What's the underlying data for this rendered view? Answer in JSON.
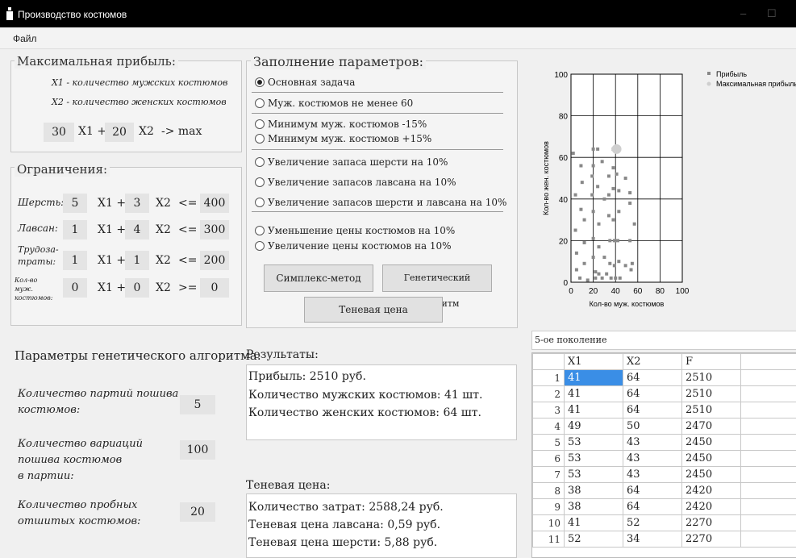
{
  "window": {
    "title": "Производство костюмов"
  },
  "menu": {
    "file": "Файл"
  },
  "maxprofit": {
    "title": "Максимальная прибыль:",
    "x1_desc": "X1 - количество мужских костюмов",
    "x2_desc": "X2 - количество женских костюмов",
    "c1": "30",
    "x1": "X1 +",
    "c2": "20",
    "x2": "X2",
    "arrow": "-> max"
  },
  "constraints": {
    "title": "Ограничения:",
    "rows": [
      {
        "label": "Шерсть:",
        "a": "5",
        "x1": "X1 +",
        "b": "3",
        "x2": "X2",
        "op": "<=",
        "rhs": "400"
      },
      {
        "label": "Лавсан:",
        "a": "1",
        "x1": "X1 +",
        "b": "4",
        "x2": "X2",
        "op": "<=",
        "rhs": "300"
      },
      {
        "label": "Трудоза-\nтраты:",
        "a": "1",
        "x1": "X1 +",
        "b": "1",
        "x2": "X2",
        "op": "<=",
        "rhs": "200"
      },
      {
        "label": "Кол-во муж. костюмов:",
        "a": "0",
        "x1": "X1 +",
        "b": "0",
        "x2": "X2",
        "op": ">=",
        "rhs": "0"
      }
    ]
  },
  "params": {
    "title": "Заполнение параметров:",
    "options": [
      "Основная задача",
      "Муж. костюмов не менее 60",
      "Минимум муж. костюмов -15%",
      "Минимум муж. костюмов +15%",
      "Увеличение запаса шерсти на 10%",
      "Увеличение запасов лавсана на 10%",
      "Увеличение запасов шерсти и лавсана на 10%",
      "Уменьшение цены костюмов на 10%",
      "Увеличение цены костюмов на 10%"
    ],
    "selected": 0
  },
  "buttons": {
    "simplex": "Симплекс-метод",
    "genetic": "Генетический алгоритм",
    "shadow": "Теневая цена"
  },
  "ga": {
    "title": "Параметры генетического алгоритма:",
    "p1_label": "Количество партий пошива\nкостюмов:",
    "p1": "5",
    "p2_label": "Количество вариаций\nпошива костюмов\nв партии:",
    "p2": "100",
    "p3_label": "Количество пробных\nотшитых костюмов:",
    "p3": "20"
  },
  "results": {
    "title": "Результаты:",
    "lines": [
      "Прибыль: 2510 руб.",
      "Количество мужских костюмов: 41 шт.",
      "Количество женских костюмов: 64 шт."
    ]
  },
  "shadow": {
    "title": "Теневая цена:",
    "lines": [
      "Количество затрат: 2588,24 руб.",
      "Теневая цена лавсана: 0,59 руб.",
      "Теневая цена шерсти: 5,88 руб."
    ]
  },
  "chart_data": {
    "type": "scatter",
    "xlabel": "Кол-во муж. костюмов",
    "ylabel": "Кол-во жен. костюмов",
    "xlim": [
      0,
      100
    ],
    "ylim": [
      0,
      100
    ],
    "xticks": [
      "0",
      "20",
      "40",
      "60",
      "80",
      "100"
    ],
    "yticks": [
      "0",
      "20",
      "40",
      "60",
      "80",
      "100"
    ],
    "grid": true,
    "legend_position": "top-right",
    "series": [
      {
        "name": "Прибыль",
        "color": "#888888",
        "points": [
          [
            2,
            62
          ],
          [
            4,
            42
          ],
          [
            4,
            25
          ],
          [
            5,
            14
          ],
          [
            5,
            6
          ],
          [
            8,
            2
          ],
          [
            9,
            56
          ],
          [
            9,
            35
          ],
          [
            10,
            48
          ],
          [
            12,
            30
          ],
          [
            12,
            19
          ],
          [
            12,
            9
          ],
          [
            15,
            1
          ],
          [
            19,
            51
          ],
          [
            19,
            42
          ],
          [
            20,
            64
          ],
          [
            20,
            56
          ],
          [
            20,
            34
          ],
          [
            20,
            21
          ],
          [
            20,
            12
          ],
          [
            22,
            5
          ],
          [
            22,
            2
          ],
          [
            24,
            64
          ],
          [
            24,
            46
          ],
          [
            25,
            28
          ],
          [
            25,
            17
          ],
          [
            25,
            4
          ],
          [
            28,
            58
          ],
          [
            28,
            2
          ],
          [
            30,
            40
          ],
          [
            30,
            12
          ],
          [
            32,
            4
          ],
          [
            34,
            51
          ],
          [
            34,
            42
          ],
          [
            34,
            32
          ],
          [
            35,
            20
          ],
          [
            35,
            9
          ],
          [
            36,
            2
          ],
          [
            38,
            64
          ],
          [
            38,
            55
          ],
          [
            38,
            45
          ],
          [
            38,
            30
          ],
          [
            39,
            20
          ],
          [
            39,
            8
          ],
          [
            40,
            2
          ],
          [
            41,
            64
          ],
          [
            41,
            52
          ],
          [
            42,
            20
          ],
          [
            43,
            44
          ],
          [
            43,
            34
          ],
          [
            43,
            10
          ],
          [
            44,
            2
          ],
          [
            49,
            50
          ],
          [
            49,
            8
          ],
          [
            53,
            43
          ],
          [
            53,
            38
          ],
          [
            53,
            20
          ],
          [
            54,
            6
          ],
          [
            55,
            9
          ],
          [
            57,
            28
          ]
        ]
      },
      {
        "name": "Максимальная прибыль",
        "color": "#cfcfcf",
        "points": [
          [
            41,
            64
          ]
        ]
      }
    ]
  },
  "generation": {
    "selected": "5-ое поколение"
  },
  "table": {
    "columns": [
      "X1",
      "X2",
      "F"
    ],
    "rows": [
      [
        "1",
        "41",
        "64",
        "2510"
      ],
      [
        "2",
        "41",
        "64",
        "2510"
      ],
      [
        "3",
        "41",
        "64",
        "2510"
      ],
      [
        "4",
        "49",
        "50",
        "2470"
      ],
      [
        "5",
        "53",
        "43",
        "2450"
      ],
      [
        "6",
        "53",
        "43",
        "2450"
      ],
      [
        "7",
        "53",
        "43",
        "2450"
      ],
      [
        "8",
        "38",
        "64",
        "2420"
      ],
      [
        "9",
        "38",
        "64",
        "2420"
      ],
      [
        "10",
        "41",
        "52",
        "2270"
      ],
      [
        "11",
        "52",
        "34",
        "2270"
      ]
    ]
  }
}
